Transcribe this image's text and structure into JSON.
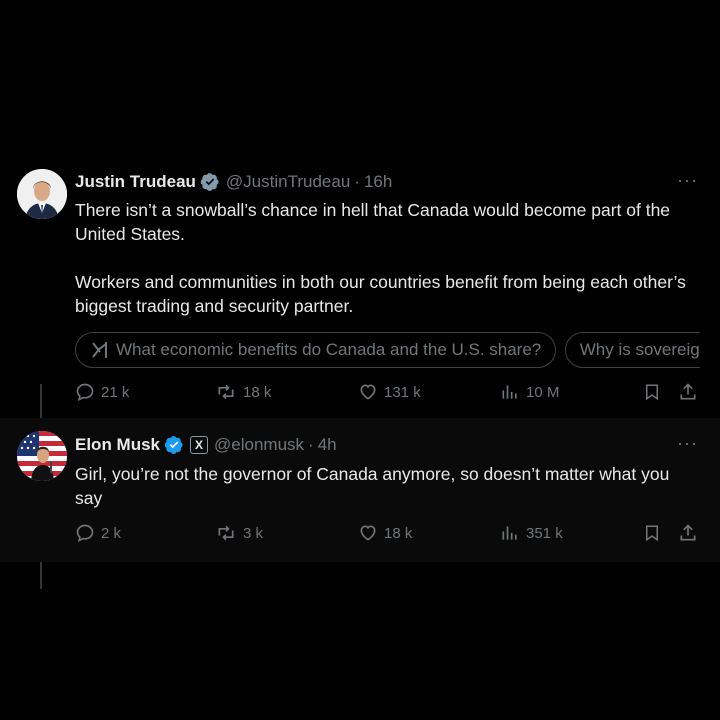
{
  "tweets": [
    {
      "author": "Justin Trudeau",
      "handle": "@JustinTrudeau",
      "separator": "·",
      "time": "16h",
      "paragraphs": [
        "There isn’t a snowball’s chance in hell that Canada would become part of the United States.",
        "Workers and communities in both our countries benefit from being each other’s biggest trading and security partner."
      ],
      "suggestions": [
        "What economic benefits do Canada and the U.S. share?",
        "Why is sovereignty important?"
      ],
      "stats": {
        "replies": "21 k",
        "reposts": "18 k",
        "likes": "131 k",
        "views": "10 M"
      }
    },
    {
      "author": "Elon Musk",
      "affiliate_badge": "X",
      "handle": "@elonmusk",
      "separator": "·",
      "time": "4h",
      "paragraphs": [
        "Girl, you’re not the governor of Canada anymore, so doesn’t matter what you say"
      ],
      "stats": {
        "replies": "2 k",
        "reposts": "3 k",
        "likes": "18 k",
        "views": "351 k"
      }
    }
  ],
  "more_icon_label": "···",
  "colors": {
    "background": "#000000",
    "text": "#e7e9ea",
    "muted": "#71767b",
    "verified": "#829aab",
    "verified_blue": "#1d9bf0"
  },
  "icons": [
    "reply-icon",
    "repost-icon",
    "like-icon",
    "views-icon",
    "bookmark-icon",
    "share-icon",
    "grok-icon",
    "verified-badge-icon"
  ]
}
